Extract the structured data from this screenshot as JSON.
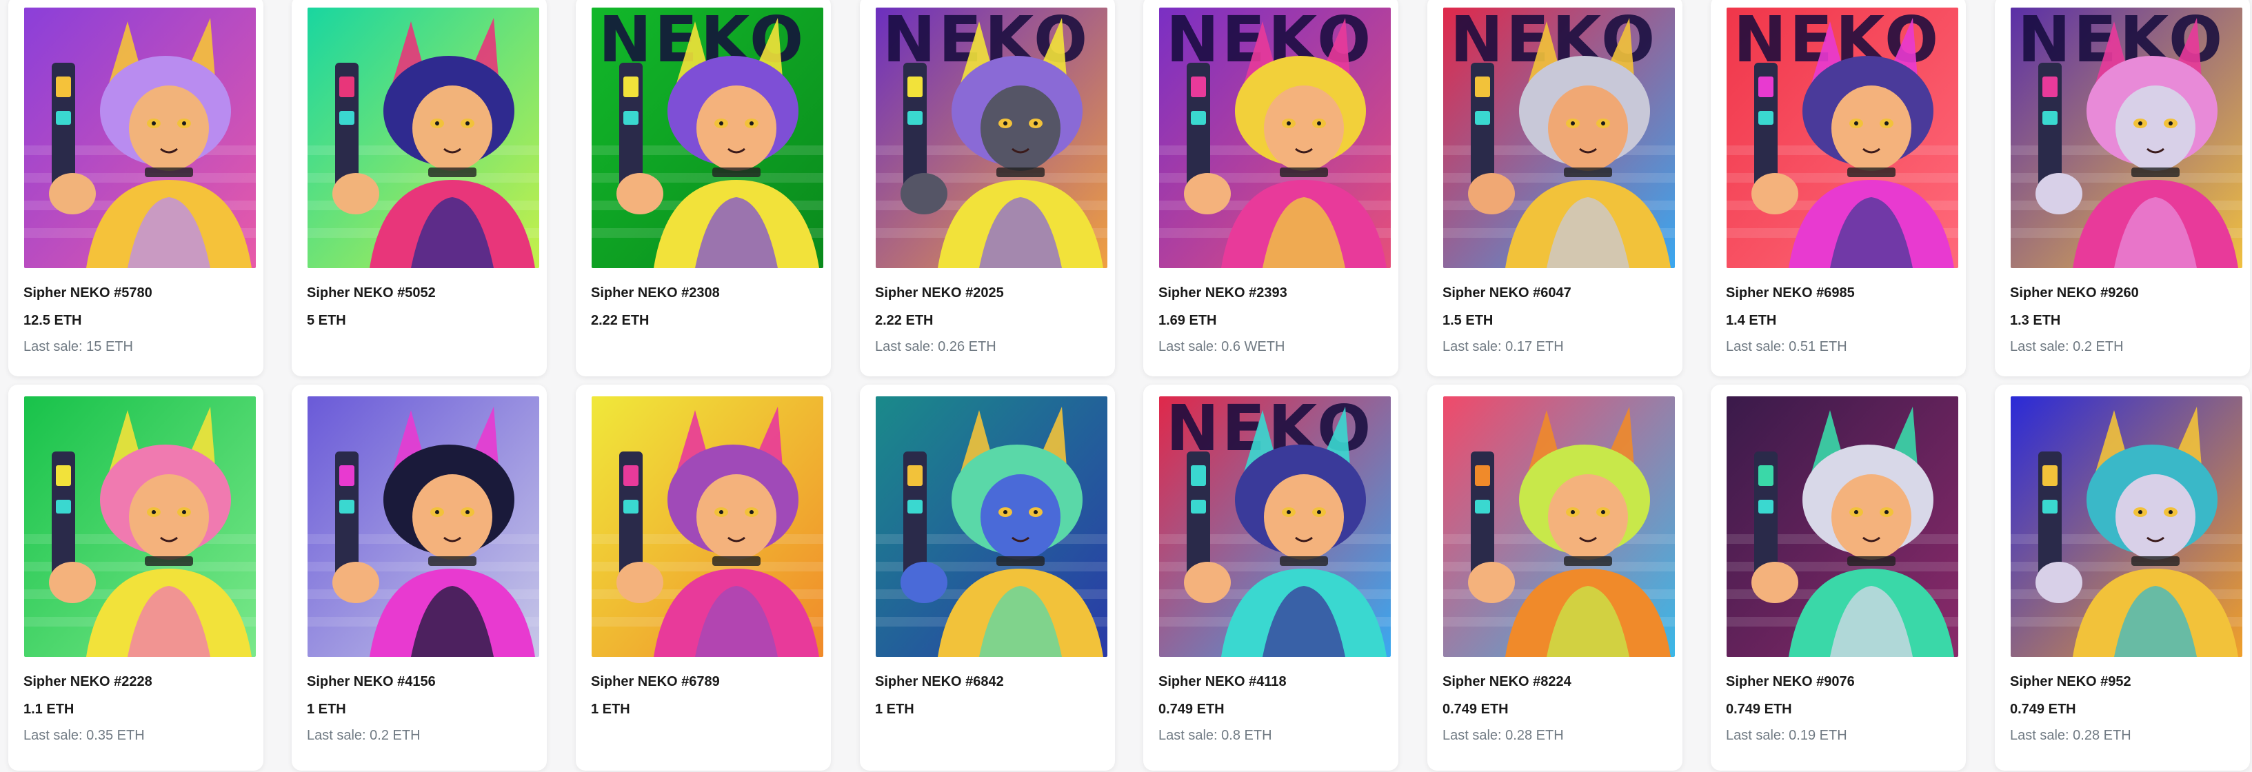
{
  "cards": [
    {
      "name": "Sipher NEKO #5780",
      "price": "12.5 ETH",
      "last_sale": "Last sale: 15 ETH",
      "bg": "#8b3fd9",
      "bg2": "#e85aa8",
      "hair": "#b98cf0",
      "accent": "#f5c23a",
      "skin": "#f2b37a",
      "banner": ""
    },
    {
      "name": "Sipher NEKO #5052",
      "price": "5 ETH",
      "last_sale": "",
      "bg": "#19d6a0",
      "bg2": "#c6f04a",
      "hair": "#2f2a8f",
      "accent": "#e8367a",
      "skin": "#f2b37a",
      "banner": ""
    },
    {
      "name": "Sipher NEKO #2308",
      "price": "2.22 ETH",
      "last_sale": "",
      "bg": "#12b82a",
      "bg2": "#0a8a1c",
      "hair": "#7e4fd6",
      "accent": "#f2e23a",
      "skin": "#f4b27c",
      "banner": "NEKO"
    },
    {
      "name": "Sipher NEKO #2025",
      "price": "2.22 ETH",
      "last_sale": "Last sale: 0.26 ETH",
      "bg": "#6b2fbf",
      "bg2": "#f0a040",
      "hair": "#8a6ad6",
      "accent": "#f2e23a",
      "skin": "#555566",
      "banner": "NEKO"
    },
    {
      "name": "Sipher NEKO #2393",
      "price": "1.69 ETH",
      "last_sale": "Last sale: 0.6 WETH",
      "bg": "#7a2fc4",
      "bg2": "#e6507a",
      "hair": "#f2d03a",
      "accent": "#e83a9a",
      "skin": "#f4b27c",
      "banner": "NEKO"
    },
    {
      "name": "Sipher NEKO #6047",
      "price": "1.5 ETH",
      "last_sale": "Last sale: 0.17 ETH",
      "bg": "#e0284a",
      "bg2": "#3aa8f0",
      "hair": "#c8c8d8",
      "accent": "#f2c23a",
      "skin": "#f0a874",
      "banner": "NEKO"
    },
    {
      "name": "Sipher NEKO #6985",
      "price": "1.4 ETH",
      "last_sale": "Last sale: 0.51 ETH",
      "bg": "#f0364a",
      "bg2": "#ff6a7a",
      "hair": "#4a3a9a",
      "accent": "#e83ad0",
      "skin": "#f4b27c",
      "banner": "NEKO"
    },
    {
      "name": "Sipher NEKO #9260",
      "price": "1.3 ETH",
      "last_sale": "Last sale: 0.2 ETH",
      "bg": "#5a2fa8",
      "bg2": "#f0c040",
      "hair": "#e88ad8",
      "accent": "#e83a9a",
      "skin": "#d8d0e8",
      "banner": "NEKO"
    },
    {
      "name": "Sipher NEKO #2228",
      "price": "1.1 ETH",
      "last_sale": "Last sale: 0.35 ETH",
      "bg": "#18c24a",
      "bg2": "#7ae88a",
      "hair": "#f07ab0",
      "accent": "#f2e23a",
      "skin": "#f4b27c",
      "banner": ""
    },
    {
      "name": "Sipher NEKO #4156",
      "price": "1 ETH",
      "last_sale": "Last sale: 0.2 ETH",
      "bg": "#6a5ad8",
      "bg2": "#c8c8e8",
      "hair": "#1a1a3a",
      "accent": "#e83ad0",
      "skin": "#f4b27c",
      "banner": ""
    },
    {
      "name": "Sipher NEKO #6789",
      "price": "1 ETH",
      "last_sale": "",
      "bg": "#f0e83a",
      "bg2": "#f08a2a",
      "hair": "#a04ab8",
      "accent": "#e83a9a",
      "skin": "#f4b27c",
      "banner": ""
    },
    {
      "name": "Sipher NEKO #6842",
      "price": "1 ETH",
      "last_sale": "",
      "bg": "#1a8a8a",
      "bg2": "#2a3aa8",
      "hair": "#5ad8a8",
      "accent": "#f2c23a",
      "skin": "#4a6ad8",
      "banner": ""
    },
    {
      "name": "Sipher NEKO #4118",
      "price": "0.749 ETH",
      "last_sale": "Last sale: 0.8 ETH",
      "bg": "#e0284a",
      "bg2": "#3aa8f0",
      "hair": "#3a3a9a",
      "accent": "#3ad8d0",
      "skin": "#f4b27c",
      "banner": "NEKO"
    },
    {
      "name": "Sipher NEKO #8224",
      "price": "0.749 ETH",
      "last_sale": "Last sale: 0.28 ETH",
      "bg": "#f04a6a",
      "bg2": "#3ab8e8",
      "hair": "#c8e84a",
      "accent": "#f08a2a",
      "skin": "#f4b27c",
      "banner": ""
    },
    {
      "name": "Sipher NEKO #9076",
      "price": "0.749 ETH",
      "last_sale": "Last sale: 0.19 ETH",
      "bg": "#3a1a4a",
      "bg2": "#8a2a6a",
      "hair": "#d8d8e8",
      "accent": "#3ad8a8",
      "skin": "#f4b27c",
      "banner": ""
    },
    {
      "name": "Sipher NEKO #952",
      "price": "0.749 ETH",
      "last_sale": "Last sale: 0.28 ETH",
      "bg": "#2a2ad8",
      "bg2": "#f0a02a",
      "hair": "#3ab8c8",
      "accent": "#f2c23a",
      "skin": "#d8d0e8",
      "banner": ""
    }
  ]
}
